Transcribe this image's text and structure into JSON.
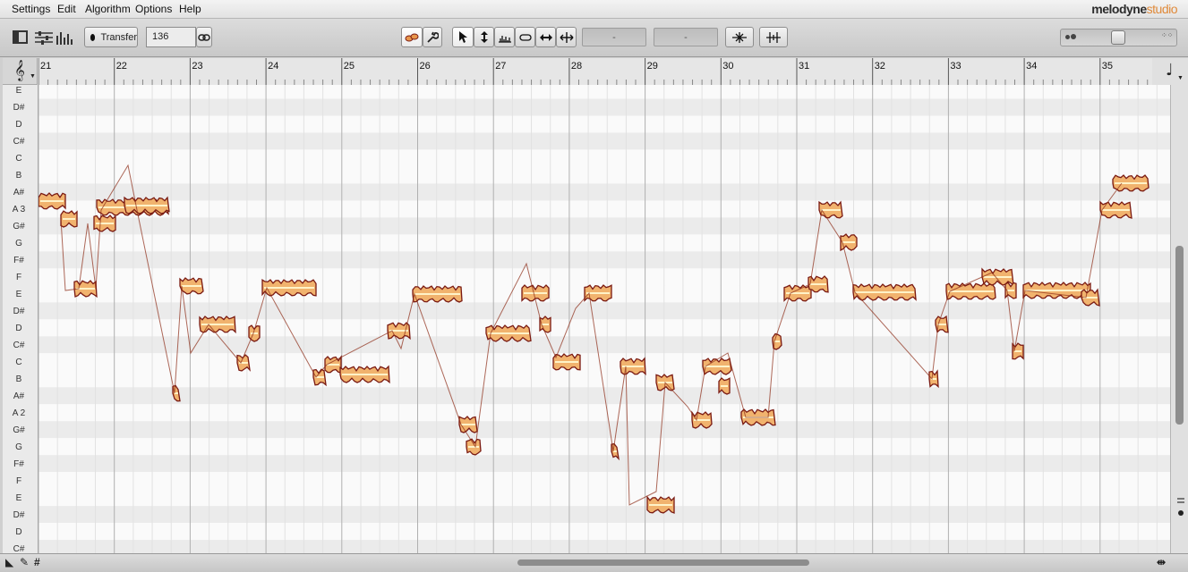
{
  "menu": [
    "Settings",
    "Edit",
    "Algorithm",
    "Options",
    "Help"
  ],
  "brand": {
    "name": "melodyne",
    "edition": "studio"
  },
  "toolbar": {
    "transfer_label": "Transfer",
    "tempo": "136",
    "field1": "-",
    "field2": "-"
  },
  "ruler": {
    "bars": [
      "21",
      "22",
      "23",
      "24",
      "25",
      "26",
      "27",
      "28",
      "29",
      "30",
      "31",
      "32",
      "33",
      "34",
      "35"
    ]
  },
  "pitch_keys": [
    "E",
    "D#",
    "D",
    "C#",
    "C",
    "B",
    "A#",
    "A 3",
    "G#",
    "G",
    "F#",
    "F",
    "E",
    "D#",
    "D",
    "C#",
    "C",
    "B",
    "A#",
    "A 2",
    "G#",
    "G",
    "F#",
    "F",
    "E",
    "D#",
    "D",
    "C#"
  ],
  "colors": {
    "blob_fill": "#f1b36e",
    "blob_outline": "#7a1a12",
    "blob_core": "#fff3c8"
  }
}
